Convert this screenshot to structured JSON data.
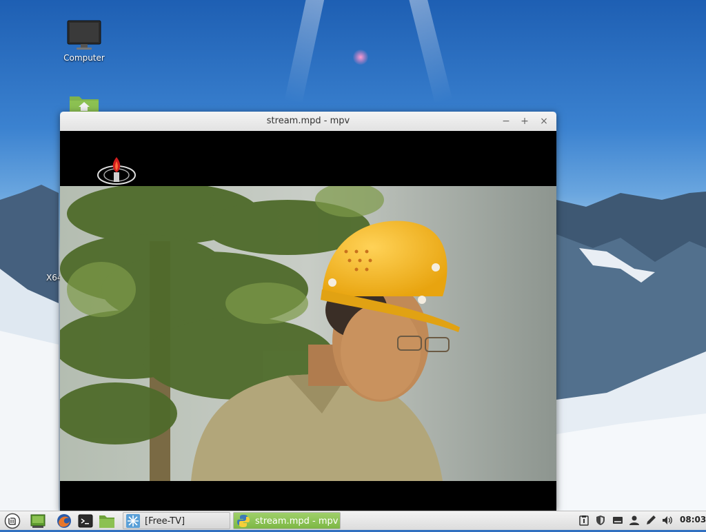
{
  "desktop": {
    "icons": [
      {
        "label": "Computer",
        "icon": "monitor-icon"
      },
      {
        "label": "",
        "icon": "home-folder-icon"
      }
    ],
    "partial_label": "X64"
  },
  "window": {
    "title": "stream.mpd - mpv",
    "controls": {
      "minimize": "−",
      "maximize": "+",
      "close": "×"
    }
  },
  "taskbar": {
    "menu_icon": "mint-menu-icon",
    "launchers": [
      "show-desktop-icon",
      "firefox-icon",
      "terminal-icon",
      "files-icon"
    ],
    "tasks": [
      {
        "label": "[Free-TV]",
        "icon": "snowflake-icon",
        "active": false
      },
      {
        "label": "stream.mpd - mpv",
        "icon": "python-icon",
        "active": true
      }
    ],
    "tray": [
      "clipboard-icon",
      "shield-icon",
      "keyboard-icon",
      "user-icon",
      "pen-icon",
      "volume-icon"
    ],
    "clock": "08:03"
  },
  "colors": {
    "task_active": "#8cc152",
    "titlebar": "#eaeaea"
  }
}
